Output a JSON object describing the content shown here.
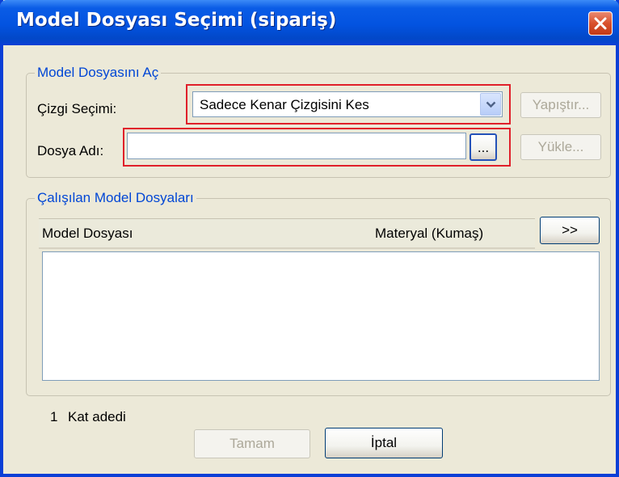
{
  "window": {
    "title": "Model Dosyası Seçimi (sipariş)"
  },
  "open_group": {
    "legend": "Model Dosyasını Aç",
    "line_label": "Çizgi Seçimi:",
    "line_selected": "Sadece Kenar Çizgisini Kes",
    "paste_label": "Yapıştır...",
    "file_label": "Dosya Adı:",
    "file_value": "",
    "browse_label": "...",
    "load_label": "Yükle..."
  },
  "working_group": {
    "legend": "Çalışılan Model Dosyaları",
    "columns": [
      "Model Dosyası",
      "Materyal (Kumaş)"
    ],
    "expand_label": ">>",
    "rows": []
  },
  "footer": {
    "layer_count": "1",
    "layer_label": "Kat adedi",
    "ok_label": "Tamam",
    "cancel_label": "İptal"
  },
  "colors": {
    "title_bar": "#0353e0",
    "legend_text": "#0046d5",
    "highlight_frame": "#e0202a",
    "close_button": "#d9502c"
  },
  "icons": {
    "close": "close-x-icon",
    "dropdown": "chevron-down-icon"
  }
}
